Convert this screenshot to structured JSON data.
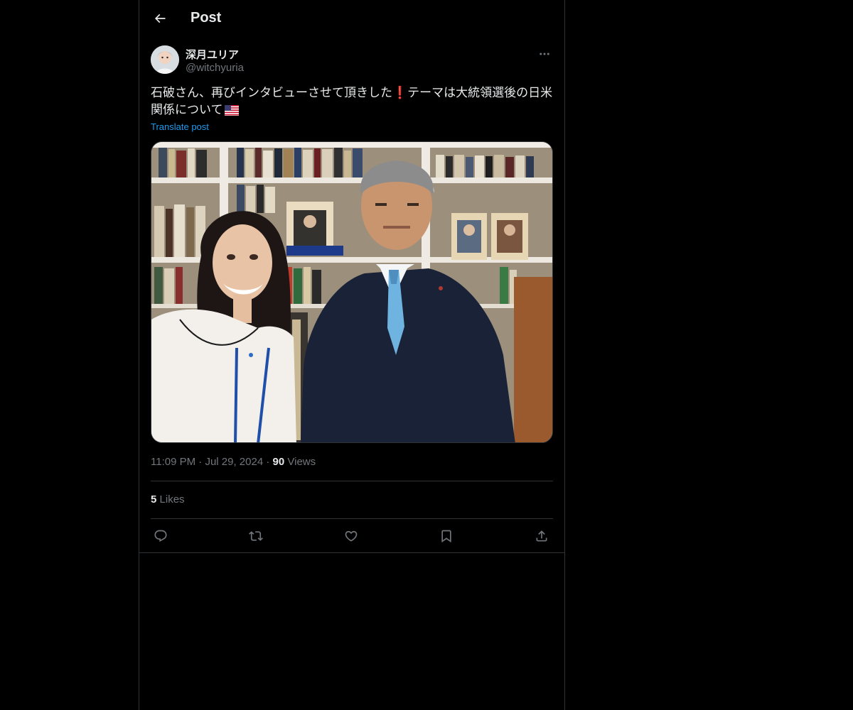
{
  "header": {
    "title": "Post",
    "back_icon": "arrow-left-icon"
  },
  "author": {
    "display_name": "深月ユリア",
    "handle": "@witchyuria",
    "more_icon": "more-horizontal-icon"
  },
  "post": {
    "text_part1": "石破さん、再びインタビューさせて頂きした",
    "text_emoji1": "❗",
    "text_part2": "テーマは大統領選後の日米関係について",
    "flag_icon": "us-flag-icon",
    "translate_label": "Translate post"
  },
  "meta": {
    "time": "11:09 PM",
    "separator": "·",
    "date": "Jul 29, 2024",
    "views_count": "90",
    "views_label": "Views"
  },
  "stats": {
    "likes_count": "5",
    "likes_label": "Likes"
  },
  "actions": [
    "reply-icon",
    "repost-icon",
    "like-icon",
    "bookmark-icon",
    "share-icon"
  ],
  "colors": {
    "background": "#000000",
    "border": "#2f3336",
    "text": "#e7e9ea",
    "secondary": "#71767b",
    "link": "#1d9bf0"
  }
}
